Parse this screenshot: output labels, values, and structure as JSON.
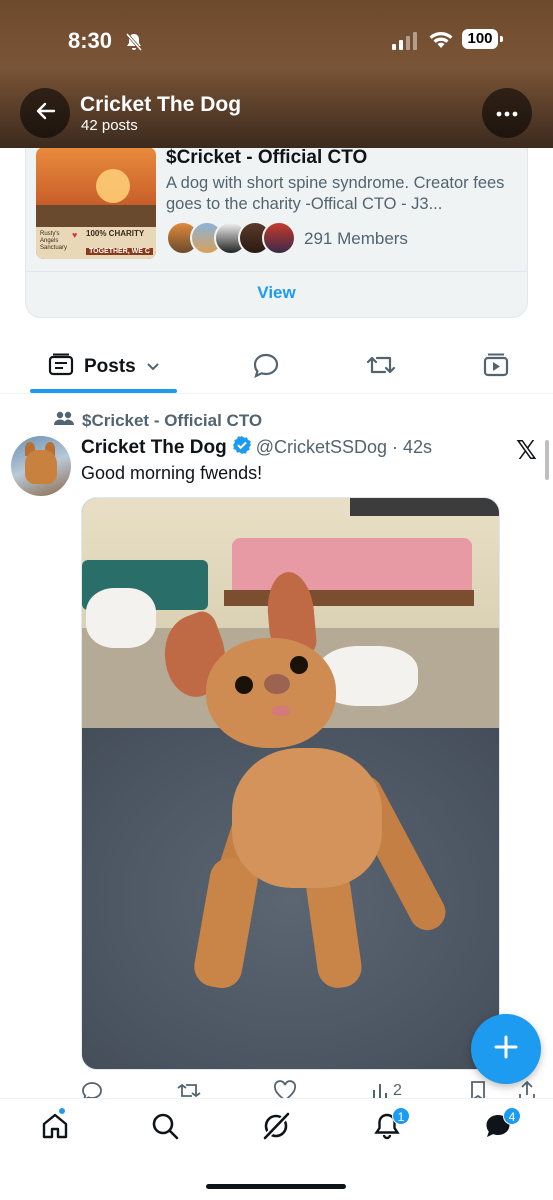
{
  "status_bar": {
    "time": "8:30",
    "battery": "100"
  },
  "header": {
    "title": "Cricket The Dog",
    "subtitle": "42 posts"
  },
  "community_card": {
    "title": "$Cricket - Official CTO",
    "description": "A dog with short spine syndrome. Creator fees goes to the charity -Offical CTO - J3...",
    "members": "291 Members",
    "view_label": "View",
    "thumbnail_text": {
      "sanctuary": "Rusty's Angels Sanctuary",
      "charity": "100% CHARITY",
      "tagline": "TOGETHER, WE C"
    }
  },
  "tabs": {
    "posts_label": "Posts"
  },
  "tweet": {
    "community": "$Cricket - Official CTO",
    "name": "Cricket The Dog",
    "handle": "@CricketSSDog · 42s",
    "text": "Good morning fwends!",
    "actions": {
      "views": "2"
    }
  },
  "bottom_nav": {
    "notifications_badge": "1",
    "messages_badge": "4"
  },
  "colors": {
    "accent": "#1d9bf0",
    "text": "#0f1419",
    "secondary": "#536471"
  }
}
